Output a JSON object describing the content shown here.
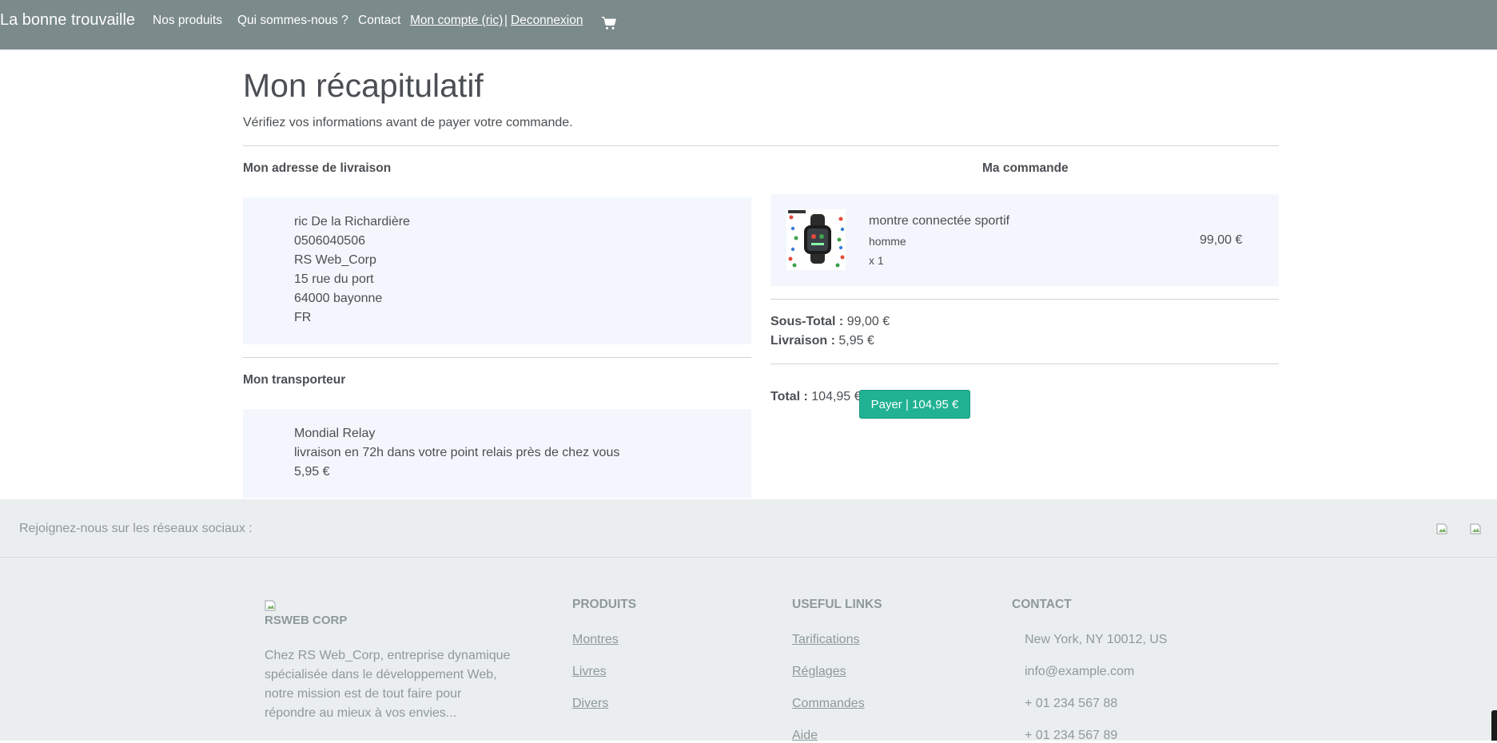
{
  "navbar": {
    "brand": "La bonne trouvaille",
    "links": [
      "Nos produits",
      "Qui sommes-nous ?",
      "Contact"
    ],
    "account": "Mon compte (ric)",
    "separator": "|",
    "logout": "Deconnexion",
    "cart_icon": "cart-icon",
    "background": "#7b8a8b"
  },
  "page": {
    "title": "Mon récapitulatif",
    "subtitle": "Vérifiez vos informations avant de payer votre commande."
  },
  "address": {
    "heading": "Mon adresse de livraison",
    "lines": [
      "ric De la Richardière",
      "0506040506",
      "RS Web_Corp",
      "15 rue du port",
      "64000 bayonne",
      "FR"
    ]
  },
  "carrier": {
    "heading": "Mon transporteur",
    "lines": [
      "Mondial Relay",
      "livraison en 72h dans votre point relais près de chez vous",
      "5,95 €"
    ]
  },
  "order": {
    "heading": "Ma commande",
    "item": {
      "name": "montre connectée sportif",
      "category": "homme",
      "quantity": "x 1",
      "price": "99,00 €"
    },
    "subtotal_label": "Sous-Total :",
    "subtotal_value": "99,00 €",
    "shipping_label": "Livraison :",
    "shipping_value": "5,95 €",
    "total_label": "Total :",
    "total_value": "104,95 €",
    "pay_button": "Payer | 104,95 €",
    "accent": "#20b292"
  },
  "footer": {
    "social_text": "Rejoignez-nous sur les réseaux sociaux :",
    "company": "RSWEB CORP",
    "description": [
      "Chez RS Web_Corp, entreprise dynamique",
      "spécialisée dans le développement Web,",
      "notre mission est de tout faire pour",
      "répondre au mieux à vos envies..."
    ],
    "products_heading": "PRODUITS",
    "products": [
      "Montres",
      "Livres",
      "Divers"
    ],
    "links_heading": "USEFUL LINKS",
    "links": [
      "Tarifications",
      "Réglages",
      "Commandes",
      "Aide"
    ],
    "contact_heading": "CONTACT",
    "contact": [
      "New York, NY 10012, US",
      "info@example.com",
      "+ 01 234 567 88",
      "+ 01 234 567 89"
    ]
  }
}
